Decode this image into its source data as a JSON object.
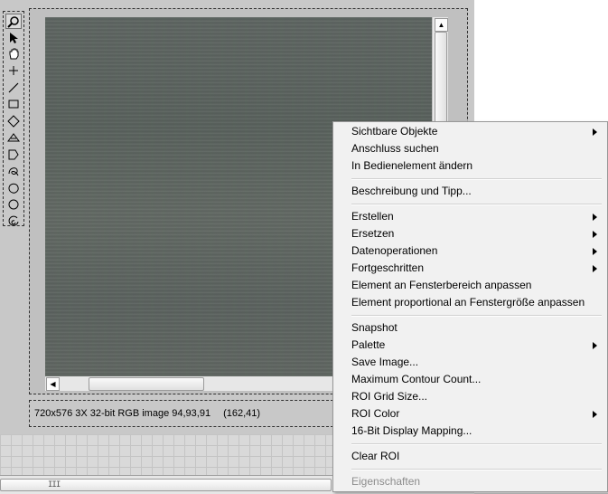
{
  "palette": {
    "tools": [
      {
        "icon": "zoom-icon"
      },
      {
        "icon": "pointer-icon"
      },
      {
        "icon": "pan-hand-icon"
      },
      {
        "icon": "crosshair-icon"
      },
      {
        "icon": "line-icon"
      },
      {
        "icon": "rectangle-icon"
      },
      {
        "icon": "rotated-rectangle-icon"
      },
      {
        "icon": "annulus-icon"
      },
      {
        "icon": "polygon-icon"
      },
      {
        "icon": "freehand-icon"
      },
      {
        "icon": "freehand-region-icon"
      },
      {
        "icon": "oval-icon"
      },
      {
        "icon": "broken-annulus-icon"
      }
    ],
    "active_index": 0
  },
  "image": {
    "h_scroll_grip": "III"
  },
  "status": {
    "image_info": "720x576 3X 32-bit RGB image 94,93,91",
    "coordinates": "(162,41)"
  },
  "context_menu": {
    "groups": [
      [
        {
          "label": "Sichtbare Objekte",
          "submenu": true
        },
        {
          "label": "Anschluss suchen",
          "submenu": false
        },
        {
          "label": "In Bedienelement ändern",
          "submenu": false
        }
      ],
      [
        {
          "label": "Beschreibung und Tipp...",
          "submenu": false
        }
      ],
      [
        {
          "label": "Erstellen",
          "submenu": true
        },
        {
          "label": "Ersetzen",
          "submenu": true
        },
        {
          "label": "Datenoperationen",
          "submenu": true
        },
        {
          "label": "Fortgeschritten",
          "submenu": true
        },
        {
          "label": "Element an Fensterbereich anpassen",
          "submenu": false
        },
        {
          "label": "Element proportional an Fenstergröße anpassen",
          "submenu": false
        }
      ],
      [
        {
          "label": "Snapshot",
          "submenu": false
        },
        {
          "label": "Palette",
          "submenu": true
        },
        {
          "label": "Save Image...",
          "submenu": false
        },
        {
          "label": "Maximum Contour Count...",
          "submenu": false
        },
        {
          "label": "ROI Grid Size...",
          "submenu": false
        },
        {
          "label": "ROI Color",
          "submenu": true
        },
        {
          "label": "16-Bit Display Mapping...",
          "submenu": false
        }
      ],
      [
        {
          "label": "Clear ROI",
          "submenu": false
        }
      ],
      [
        {
          "label": "Eigenschaften",
          "submenu": false,
          "disabled": true
        }
      ]
    ]
  }
}
